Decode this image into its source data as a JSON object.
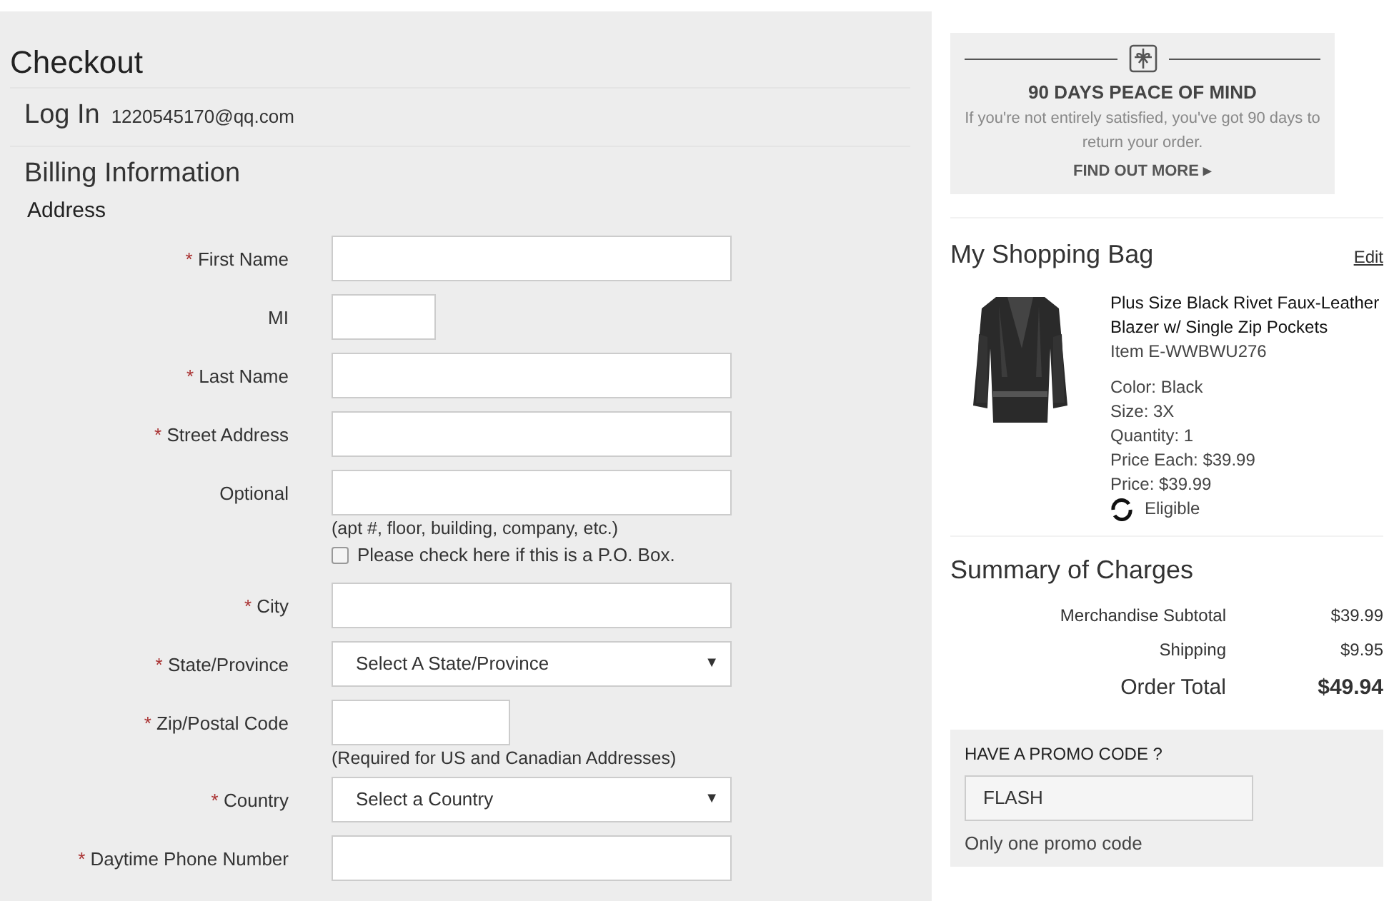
{
  "title": "Checkout",
  "login": {
    "label": "Log In",
    "email": "1220545170@qq.com"
  },
  "billing": {
    "title": "Billing Information",
    "subtitle": "Address",
    "fields": [
      {
        "kind": "text",
        "label": "First Name",
        "required": true
      },
      {
        "kind": "short-text",
        "label": "MI",
        "required": false
      },
      {
        "kind": "text",
        "label": "Last Name",
        "required": true
      },
      {
        "kind": "text",
        "label": "Street Address",
        "required": true
      },
      {
        "kind": "text",
        "label": "Optional",
        "required": false,
        "hint": "(apt #, floor, building, company, etc.)"
      },
      {
        "kind": "checkbox",
        "label": "Please check here if this is a P.O. Box.",
        "checked": false
      },
      {
        "kind": "text",
        "label": "City",
        "required": true
      },
      {
        "kind": "select",
        "label": "State/Province",
        "required": true,
        "value": "Select A State/Province",
        "caret": "▼"
      },
      {
        "kind": "mid-text",
        "label": "Zip/Postal Code",
        "required": true,
        "hint": "(Required for US and Canadian Addresses)"
      },
      {
        "kind": "select",
        "label": "Country",
        "required": true,
        "value": "Select a Country",
        "caret": "▼"
      },
      {
        "kind": "text",
        "label": "Daytime Phone Number",
        "required": true
      }
    ],
    "required_mark": "*"
  },
  "guarantee": {
    "title": "90 DAYS PEACE OF MIND",
    "text": "If you're not entirely satisfied, you've got 90 days to return your order.",
    "link": "FIND OUT MORE",
    "link_caret": "▸"
  },
  "bag": {
    "title": "My Shopping Bag",
    "edit": "Edit",
    "items": [
      {
        "kind": "picture",
        "name": "Plus Size Black Rivet Faux-Leather Blazer w/ Single Zip Pockets",
        "item": "Item E-WWBWU276",
        "details": [
          "Color: Black",
          "Size: 3X",
          "Quantity: 1",
          "Price Each: $39.99",
          "Price: $39.99"
        ],
        "eligible": "Eligible"
      }
    ]
  },
  "summary": {
    "title": "Summary of Charges",
    "rows": [
      {
        "label": "Merchandise Subtotal",
        "value": "$39.99",
        "total": false
      },
      {
        "label": "Shipping",
        "value": "$9.95",
        "total": false
      },
      {
        "label": "Order Total",
        "value": "$49.94",
        "total": true
      }
    ]
  },
  "promo": {
    "title": "HAVE A PROMO CODE ?",
    "value": "FLASH",
    "note": "Only one promo code"
  }
}
